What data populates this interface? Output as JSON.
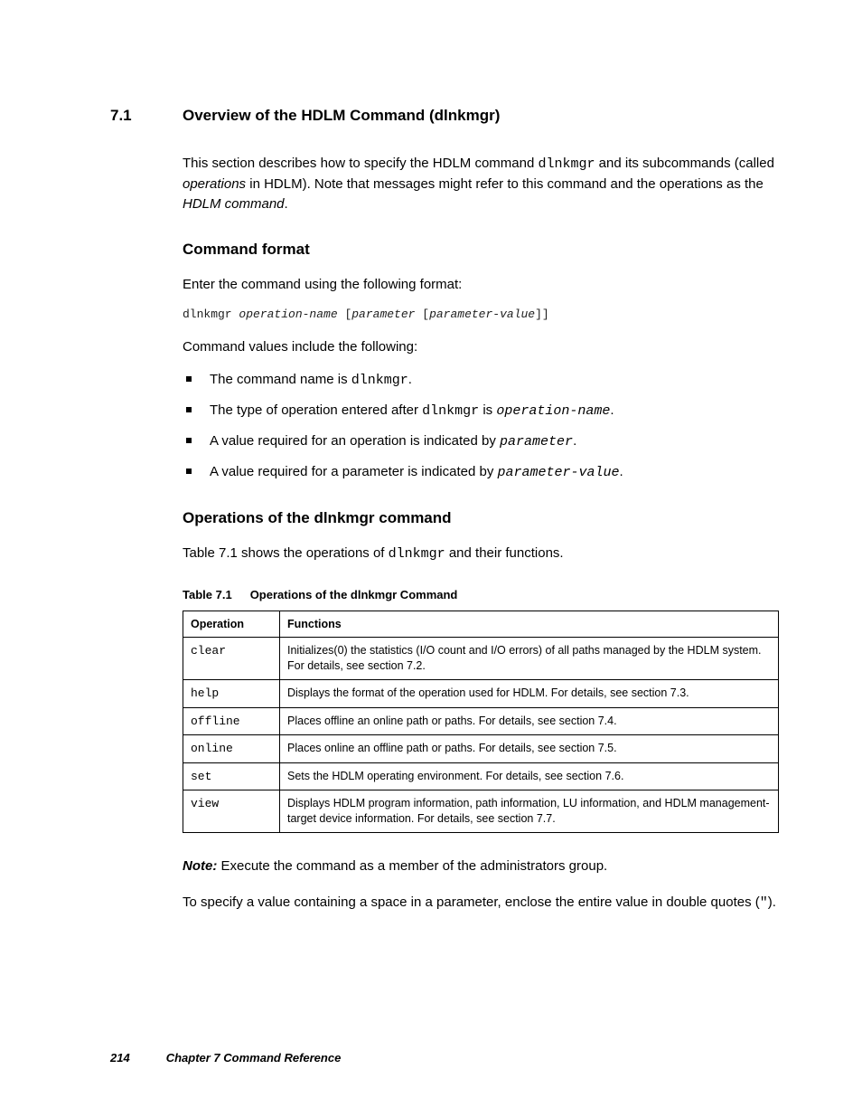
{
  "section": {
    "number": "7.1",
    "title": "Overview of the HDLM Command (dlnkmgr)"
  },
  "intro": {
    "part1": "This section describes how to specify the HDLM command ",
    "cmd": "dlnkmgr",
    "part2": " and its subcommands (called ",
    "ital1": "operations",
    "part3": " in HDLM). Note that messages might refer to this command and the operations as the ",
    "ital2": "HDLM command",
    "part4": "."
  },
  "sub1": "Command format",
  "format_intro": "Enter the command using the following format:",
  "code": {
    "c1": "dlnkmgr ",
    "c2": "operation-name",
    "c3": " [",
    "c4": "parameter",
    "c5": " [",
    "c6": "parameter-value",
    "c7": "]]"
  },
  "values_intro": "Command values include the following:",
  "bullets": {
    "b1a": "The command name is ",
    "b1b": "dlnkmgr",
    "b1c": ".",
    "b2a": "The type of operation entered after ",
    "b2b": "dlnkmgr",
    "b2c": " is ",
    "b2d": "operation-name",
    "b2e": ".",
    "b3a": "A value required for an operation is indicated by ",
    "b3b": "parameter",
    "b3c": ".",
    "b4a": "A value required for a parameter is indicated by ",
    "b4b": "parameter-value",
    "b4c": "."
  },
  "sub2": "Operations of the dlnkmgr command",
  "ops_intro": {
    "a": "Table 7.1 shows the operations of ",
    "b": "dlnkmgr",
    "c": " and their functions."
  },
  "table": {
    "caption_num": "Table 7.1",
    "caption_title": "Operations of the dlnkmgr Command",
    "h1": "Operation",
    "h2": "Functions",
    "rows": [
      {
        "op": "clear",
        "fn": "Initializes(0) the statistics (I/O count and I/O errors) of all paths managed by the HDLM system. For details, see section 7.2."
      },
      {
        "op": "help",
        "fn": "Displays the format of the operation used for HDLM. For details, see section 7.3."
      },
      {
        "op": "offline",
        "fn": "Places offline an online path or paths. For details, see section 7.4."
      },
      {
        "op": "online",
        "fn": "Places online an offline path or paths. For details, see section 7.5."
      },
      {
        "op": "set",
        "fn": "Sets the HDLM operating environment. For details, see section 7.6."
      },
      {
        "op": "view",
        "fn": "Displays HDLM program information, path information, LU information, and HDLM management-target device information. For details, see section 7.7."
      }
    ]
  },
  "note": {
    "label": "Note:",
    "text": " Execute the command as a member of the administrators group."
  },
  "closing": {
    "a": "To specify a value containing a space in a parameter, enclose the entire value in double quotes (",
    "q": "\"",
    "b": ")."
  },
  "footer": {
    "page": "214",
    "chapter": "Chapter 7   Command  Reference"
  }
}
